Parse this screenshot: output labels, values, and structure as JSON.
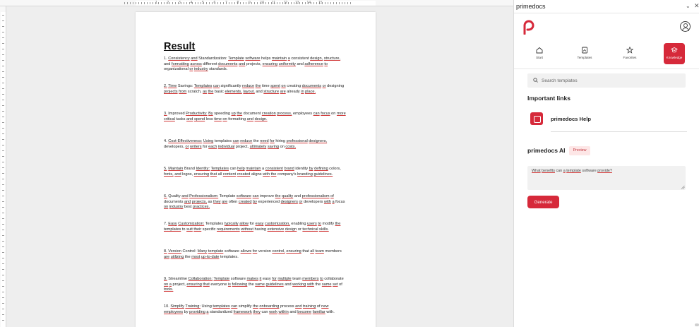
{
  "document": {
    "title": "Result",
    "ruler_numbers": [
      "1",
      "2",
      "3",
      "4",
      "5",
      "6",
      "7",
      "8",
      "9",
      "10",
      "11",
      "12",
      "13",
      "14",
      "15"
    ],
    "items": [
      "1. Consistency and Standardization: Template software helps maintain a consistent design, structure, and formatting across different documents and projects, ensuring uniformity and adherence to organizational or industry standards.",
      "2. Time Savings: Templates can significantly reduce the time spent on creating documents or designing projects from scratch, as the basic elements, layout, and structure are already in place.",
      "3. Improved Productivity: By speeding up the document creation process, employees can focus on more critical tasks and spend less time on formatting and design.",
      "4. Cost-Effectiveness: Using templates can reduce the need for hiring professional designers, developers, or writers for each individual project, ultimately saving on costs.",
      "5. Maintain Brand Identity: Templates can help maintain a consistent brand identity by defining colors, fonts, and logos, ensuring that all content created aligns with the company's branding guidelines.",
      "6. Quality and Professionalism: Template software can improve the quality and professionalism of documents and projects, as they are often created by experienced designers or developers with a focus on industry best practices.",
      "7. Easy Customization: Templates typically allow for easy customization, enabling users to modify the templates to suit their specific requirements without having extensive design or technical skills.",
      "8. Version Control: Many template software allows for version control, ensuring that all team members are utilizing the most up-to-date templates.",
      "9. Streamline Collaboration: Template software makes it easy for multiple team members to collaborate on a project, ensuring that everyone is following the same guidelines and working with the same set of tools.",
      "10. Simplify Training: Using templates can simplify the onboarding process and training of new employees by providing a standardized framework they can work within and become familiar with."
    ]
  },
  "panel": {
    "title": "primedocs",
    "nav": [
      {
        "label": "Start",
        "icon": "home-icon"
      },
      {
        "label": "Templates",
        "icon": "templates-icon"
      },
      {
        "label": "Favorites",
        "icon": "star-icon"
      },
      {
        "label": "Knowledge",
        "icon": "graduation-cap-icon",
        "active": true
      }
    ],
    "search": {
      "placeholder": "Search templates"
    },
    "links_heading": "Important links",
    "links": [
      {
        "label": "primedocs Help"
      }
    ],
    "ai": {
      "heading": "primedocs AI",
      "badge": "Preview",
      "prompt": "What benefits can a template software provide?",
      "generate_label": "Generate"
    },
    "accent_color": "#d6293a"
  }
}
